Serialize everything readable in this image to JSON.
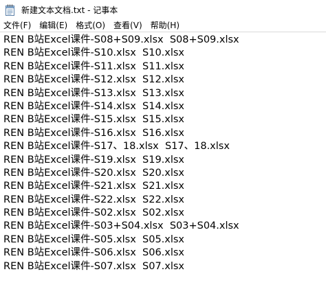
{
  "window": {
    "title": "新建文本文档.txt - 记事本",
    "icon": "notepad-icon"
  },
  "menu": {
    "items": [
      {
        "id": "file",
        "label": "文件(F)"
      },
      {
        "id": "edit",
        "label": "编辑(E)"
      },
      {
        "id": "format",
        "label": "格式(O)"
      },
      {
        "id": "view",
        "label": "查看(V)"
      },
      {
        "id": "help",
        "label": "帮助(H)"
      }
    ]
  },
  "editor": {
    "lines": [
      "REN B站Excel课件-S08+S09.xlsx  S08+S09.xlsx",
      "REN B站Excel课件-S10.xlsx  S10.xlsx",
      "REN B站Excel课件-S11.xlsx  S11.xlsx",
      "REN B站Excel课件-S12.xlsx  S12.xlsx",
      "REN B站Excel课件-S13.xlsx  S13.xlsx",
      "REN B站Excel课件-S14.xlsx  S14.xlsx",
      "REN B站Excel课件-S15.xlsx  S15.xlsx",
      "REN B站Excel课件-S16.xlsx  S16.xlsx",
      "REN B站Excel课件-S17、18.xlsx  S17、18.xlsx",
      "REN B站Excel课件-S19.xlsx  S19.xlsx",
      "REN B站Excel课件-S20.xlsx  S20.xlsx",
      "REN B站Excel课件-S21.xlsx  S21.xlsx",
      "REN B站Excel课件-S22.xlsx  S22.xlsx",
      "REN B站Excel课件-S02.xlsx  S02.xlsx",
      "REN B站Excel课件-S03+S04.xlsx  S03+S04.xlsx",
      "REN B站Excel课件-S05.xlsx  S05.xlsx",
      "REN B站Excel课件-S06.xlsx  S06.xlsx",
      "REN B站Excel课件-S07.xlsx  S07.xlsx"
    ]
  }
}
